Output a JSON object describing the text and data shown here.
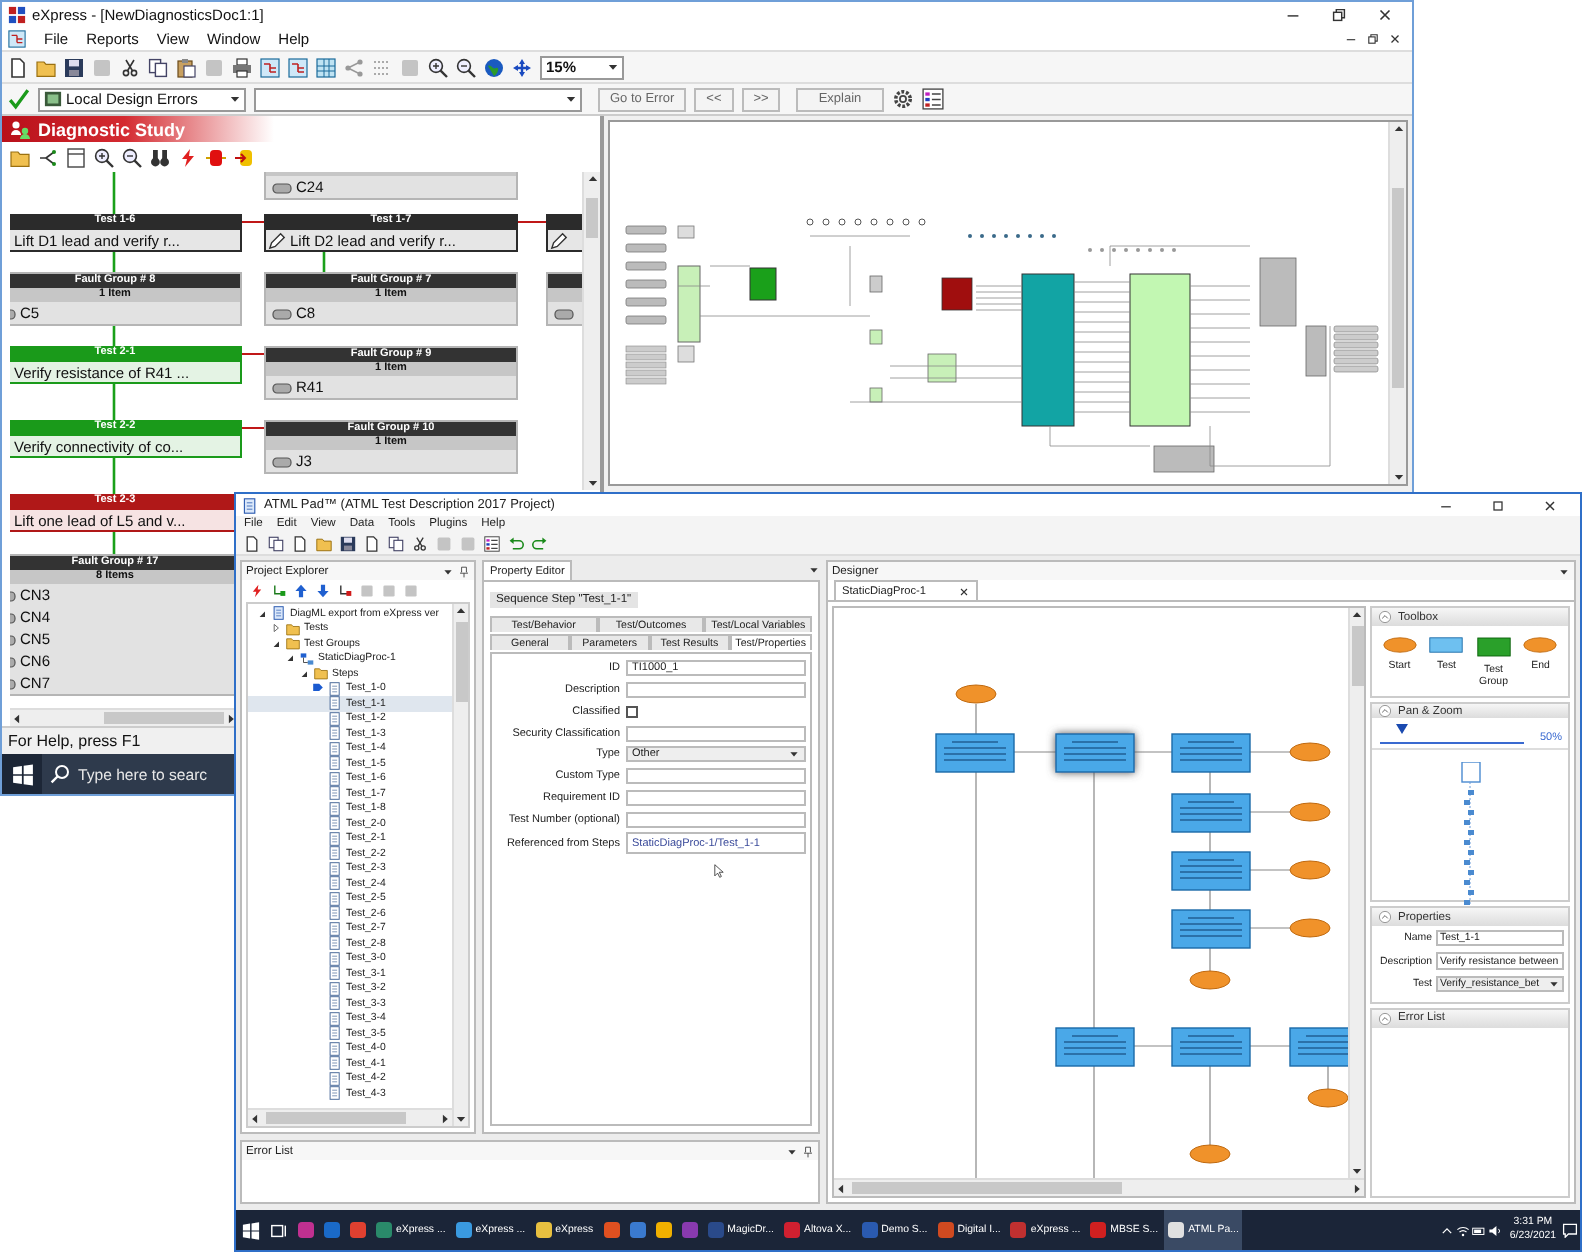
{
  "express_window": {
    "title": "eXpress - [NewDiagnosticsDoc1:1]",
    "menu": [
      "File",
      "Reports",
      "View",
      "Window",
      "Help"
    ],
    "zoom": "15%",
    "error_filter": "Local Design Errors",
    "nav_buttons": [
      "Go to Error",
      "<<",
      ">>",
      "Explain"
    ],
    "diagnostic_study": {
      "title": "Diagnostic Study",
      "nodes": [
        {
          "kind": "fault-group",
          "items": [
            "C24"
          ]
        },
        {
          "kind": "test",
          "color": "#2b2b2b",
          "title": "Test 1-6",
          "text": "Lift D1 lead and verify r..."
        },
        {
          "kind": "test",
          "color": "#2b2b2b",
          "title": "Test 1-7",
          "text": "Lift D2 lead and verify r..."
        },
        {
          "kind": "test",
          "color": "#2b2b2b"
        },
        {
          "kind": "fault-group",
          "title": "Fault Group # 8",
          "count": "1 Item",
          "items": [
            "C5"
          ]
        },
        {
          "kind": "fault-group",
          "title": "Fault Group # 7",
          "count": "1 Item",
          "items": [
            "C8"
          ]
        },
        {
          "kind": "fault-group"
        },
        {
          "kind": "test",
          "color": "#1a9a1a",
          "title": "Test 2-1",
          "text": "Verify resistance of R41 ..."
        },
        {
          "kind": "fault-group",
          "title": "Fault Group # 9",
          "count": "1 Item",
          "items": [
            "R41"
          ]
        },
        {
          "kind": "test",
          "color": "#1a9a1a",
          "title": "Test 2-2",
          "text": "Verify connectivity of co..."
        },
        {
          "kind": "fault-group",
          "title": "Fault Group # 10",
          "count": "1 Item",
          "items": [
            "J3"
          ]
        },
        {
          "kind": "test",
          "color": "#b01818",
          "title": "Test 2-3",
          "text": "Lift one lead of L5 and v..."
        },
        {
          "kind": "fault-group",
          "title": "Fault Group # 17",
          "count": "8 Items",
          "items": [
            "CN3",
            "CN4",
            "CN5",
            "CN6",
            "CN7"
          ]
        }
      ]
    },
    "status_bar": "For Help, press F1",
    "taskbar_search": {
      "placeholder": "Type here to searc"
    }
  },
  "atml_window": {
    "title": "ATML Pad™ (ATML Test Description 2017 Project)",
    "menu": [
      "File",
      "Edit",
      "View",
      "Data",
      "Tools",
      "Plugins",
      "Help"
    ],
    "project_explorer": {
      "title": "Project Explorer",
      "tree": [
        {
          "kind": "document",
          "label": "DiagML export from eXpress ver",
          "expanded": true,
          "selected": false,
          "children": [
            {
              "kind": "folder",
              "label": "Tests",
              "expanded": false,
              "selected": false
            },
            {
              "kind": "folder",
              "label": "Test Groups",
              "expanded": true,
              "selected": false,
              "children": [
                {
                  "kind": "procedure",
                  "label": "StaticDiagProc-1",
                  "expanded": true,
                  "selected": false,
                  "children": [
                    {
                      "kind": "folder",
                      "label": "Steps",
                      "expanded": true,
                      "selected": false,
                      "children": [
                        {
                          "kind": "start-step",
                          "label": "Test_1-0",
                          "selected": false
                        },
                        {
                          "kind": "step",
                          "label": "Test_1-1",
                          "selected": true
                        },
                        {
                          "kind": "step",
                          "label": "Test_1-2",
                          "selected": false
                        },
                        {
                          "kind": "step",
                          "label": "Test_1-3",
                          "selected": false
                        },
                        {
                          "kind": "step",
                          "label": "Test_1-4",
                          "selected": false
                        },
                        {
                          "kind": "step",
                          "label": "Test_1-5",
                          "selected": false
                        },
                        {
                          "kind": "step",
                          "label": "Test_1-6",
                          "selected": false
                        },
                        {
                          "kind": "step",
                          "label": "Test_1-7",
                          "selected": false
                        },
                        {
                          "kind": "step",
                          "label": "Test_1-8",
                          "selected": false
                        },
                        {
                          "kind": "step",
                          "label": "Test_2-0",
                          "selected": false
                        },
                        {
                          "kind": "step",
                          "label": "Test_2-1",
                          "selected": false
                        },
                        {
                          "kind": "step",
                          "label": "Test_2-2",
                          "selected": false
                        },
                        {
                          "kind": "step",
                          "label": "Test_2-3",
                          "selected": false
                        },
                        {
                          "kind": "step",
                          "label": "Test_2-4",
                          "selected": false
                        },
                        {
                          "kind": "step",
                          "label": "Test_2-5",
                          "selected": false
                        },
                        {
                          "kind": "step",
                          "label": "Test_2-6",
                          "selected": false
                        },
                        {
                          "kind": "step",
                          "label": "Test_2-7",
                          "selected": false
                        },
                        {
                          "kind": "step",
                          "label": "Test_2-8",
                          "selected": false
                        },
                        {
                          "kind": "step",
                          "label": "Test_3-0",
                          "selected": false
                        },
                        {
                          "kind": "step",
                          "label": "Test_3-1",
                          "selected": false
                        },
                        {
                          "kind": "step",
                          "label": "Test_3-2",
                          "selected": false
                        },
                        {
                          "kind": "step",
                          "label": "Test_3-3",
                          "selected": false
                        },
                        {
                          "kind": "step",
                          "label": "Test_3-4",
                          "selected": false
                        },
                        {
                          "kind": "step",
                          "label": "Test_3-5",
                          "selected": false
                        },
                        {
                          "kind": "step",
                          "label": "Test_4-0",
                          "selected": false
                        },
                        {
                          "kind": "step",
                          "label": "Test_4-1",
                          "selected": false
                        },
                        {
                          "kind": "step",
                          "label": "Test_4-2",
                          "selected": false
                        },
                        {
                          "kind": "step",
                          "label": "Test_4-3",
                          "selected": false
                        }
                      ]
                    }
                  ]
                }
              ]
            }
          ]
        }
      ]
    },
    "property_editor": {
      "title": "Property Editor",
      "heading": "Sequence Step \"Test_1-1\"",
      "tab_rows": [
        [
          {
            "label": "Test/Behavior",
            "selected": false
          },
          {
            "label": "Test/Outcomes",
            "selected": false
          },
          {
            "label": "Test/Local Variables",
            "selected": false
          }
        ],
        [
          {
            "label": "General",
            "selected": false
          },
          {
            "label": "Parameters",
            "selected": false
          },
          {
            "label": "Test Results",
            "selected": false
          },
          {
            "label": "Test/Properties",
            "selected": true
          }
        ]
      ],
      "fields": [
        {
          "kind": "text",
          "label": "ID",
          "value": "TI1000_1"
        },
        {
          "kind": "text",
          "label": "Description"
        },
        {
          "kind": "checkbox",
          "label": "Classified",
          "checked": false
        },
        {
          "kind": "text",
          "label": "Security Classification"
        },
        {
          "kind": "select",
          "label": "Type",
          "value": "Other"
        },
        {
          "kind": "text",
          "label": "Custom Type"
        },
        {
          "kind": "text",
          "label": "Requirement ID"
        },
        {
          "kind": "text",
          "label": "Test Number (optional)"
        },
        {
          "kind": "link",
          "label": "Referenced from Steps",
          "value": "StaticDiagProc-1/Test_1-1"
        }
      ]
    },
    "error_list": {
      "title": "Error List"
    },
    "designer": {
      "title": "Designer",
      "tabs": [
        {
          "label": "StaticDiagProc-1",
          "selected": true
        }
      ],
      "toolbox": {
        "title": "Toolbox",
        "items": [
          {
            "kind": "start",
            "label": "Start"
          },
          {
            "kind": "test",
            "label": "Test"
          },
          {
            "kind": "group",
            "label": "Test Group"
          },
          {
            "kind": "end",
            "label": "End"
          }
        ]
      },
      "pan_zoom": {
        "title": "Pan & Zoom",
        "level": 0.15,
        "reading": "50%"
      },
      "properties": {
        "title": "Properties",
        "fields": [
          {
            "kind": "text",
            "label": "Name",
            "value": "Test_1-1"
          },
          {
            "kind": "text",
            "label": "Description",
            "value": "Verify resistance between"
          },
          {
            "kind": "select",
            "label": "Test",
            "value": "Verify_resistance_bet"
          }
        ]
      },
      "error_list": {
        "title": "Error List"
      }
    },
    "taskbar": {
      "items": [
        {
          "kind": "start",
          "selected": false
        },
        {
          "kind": "task-view",
          "selected": false
        },
        {
          "kind": "pinned",
          "color": "#c03090",
          "selected": false
        },
        {
          "kind": "pinned",
          "color": "#1a6ac8",
          "selected": false
        },
        {
          "kind": "pinned",
          "color": "#e04030",
          "selected": false
        },
        {
          "kind": "window",
          "label": "eXpress ...",
          "color": "#2a8a6a",
          "selected": false
        },
        {
          "kind": "window",
          "label": "eXpress ...",
          "color": "#3a9ae0",
          "selected": false
        },
        {
          "kind": "window",
          "label": "eXpress",
          "color": "#e8c040",
          "selected": false
        },
        {
          "kind": "pinned",
          "color": "#e05020",
          "selected": false
        },
        {
          "kind": "pinned",
          "color": "#3a7ad0",
          "selected": false
        },
        {
          "kind": "pinned",
          "color": "#f0b000",
          "selected": false
        },
        {
          "kind": "pinned",
          "color": "#8a3ab0",
          "selected": false
        },
        {
          "kind": "window",
          "label": "MagicDr...",
          "color": "#2a4a8a",
          "selected": false
        },
        {
          "kind": "window",
          "label": "Altova X...",
          "color": "#d02030",
          "selected": false
        },
        {
          "kind": "window",
          "label": "Demo S...",
          "color": "#2a5ab0",
          "selected": false
        },
        {
          "kind": "window",
          "label": "Digital I...",
          "color": "#d04a20",
          "selected": false
        },
        {
          "kind": "window",
          "label": "eXpress ...",
          "color": "#c03030",
          "selected": false
        },
        {
          "kind": "window",
          "label": "MBSE S...",
          "color": "#d02020",
          "selected": false
        },
        {
          "kind": "window",
          "label": "ATML Pa...",
          "color": "#e0e0e0",
          "selected": true
        }
      ],
      "time": "3:31 PM",
      "date": "6/23/2021"
    }
  }
}
